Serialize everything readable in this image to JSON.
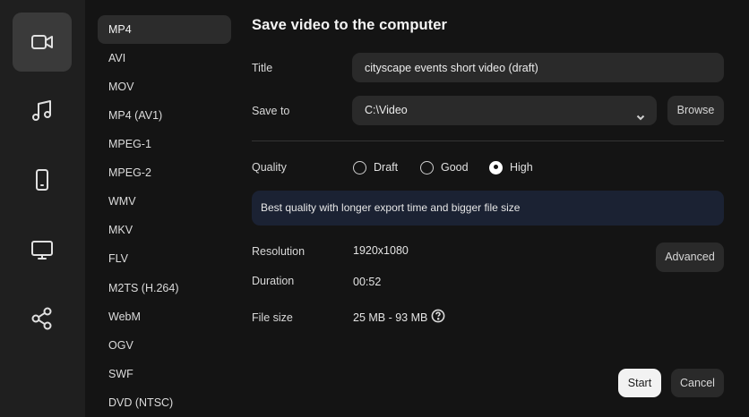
{
  "rail": {
    "items": [
      {
        "icon": "video-camera-icon",
        "active": true
      },
      {
        "icon": "music-note-icon",
        "active": false
      },
      {
        "icon": "phone-icon",
        "active": false
      },
      {
        "icon": "monitor-icon",
        "active": false
      },
      {
        "icon": "share-icon",
        "active": false
      }
    ]
  },
  "formats": {
    "selected": "MP4",
    "items": [
      "MP4",
      "AVI",
      "MOV",
      "MP4 (AV1)",
      "MPEG-1",
      "MPEG-2",
      "WMV",
      "MKV",
      "FLV",
      "M2TS (H.264)",
      "WebM",
      "OGV",
      "SWF",
      "DVD (NTSC)"
    ]
  },
  "main": {
    "title": "Save video to the computer",
    "title_label": "Title",
    "title_value": "cityscape events short video (draft)",
    "save_to_label": "Save to",
    "save_to_value": "C:\\Video",
    "browse_label": "Browse",
    "quality_label": "Quality",
    "quality_options": [
      "Draft",
      "Good",
      "High"
    ],
    "quality_selected": "High",
    "quality_info": "Best quality with longer export time and bigger file size",
    "resolution_label": "Resolution",
    "resolution_value": "1920x1080",
    "advanced_label": "Advanced",
    "duration_label": "Duration",
    "duration_value": "00:52",
    "filesize_label": "File size",
    "filesize_value": "25 MB - 93 MB",
    "start_label": "Start",
    "cancel_label": "Cancel"
  },
  "colors": {
    "background": "#141414",
    "rail": "#1f1f1f",
    "control": "#2a2a2a",
    "info_box": "#1b2233",
    "primary_button": "#f2f2f2"
  }
}
